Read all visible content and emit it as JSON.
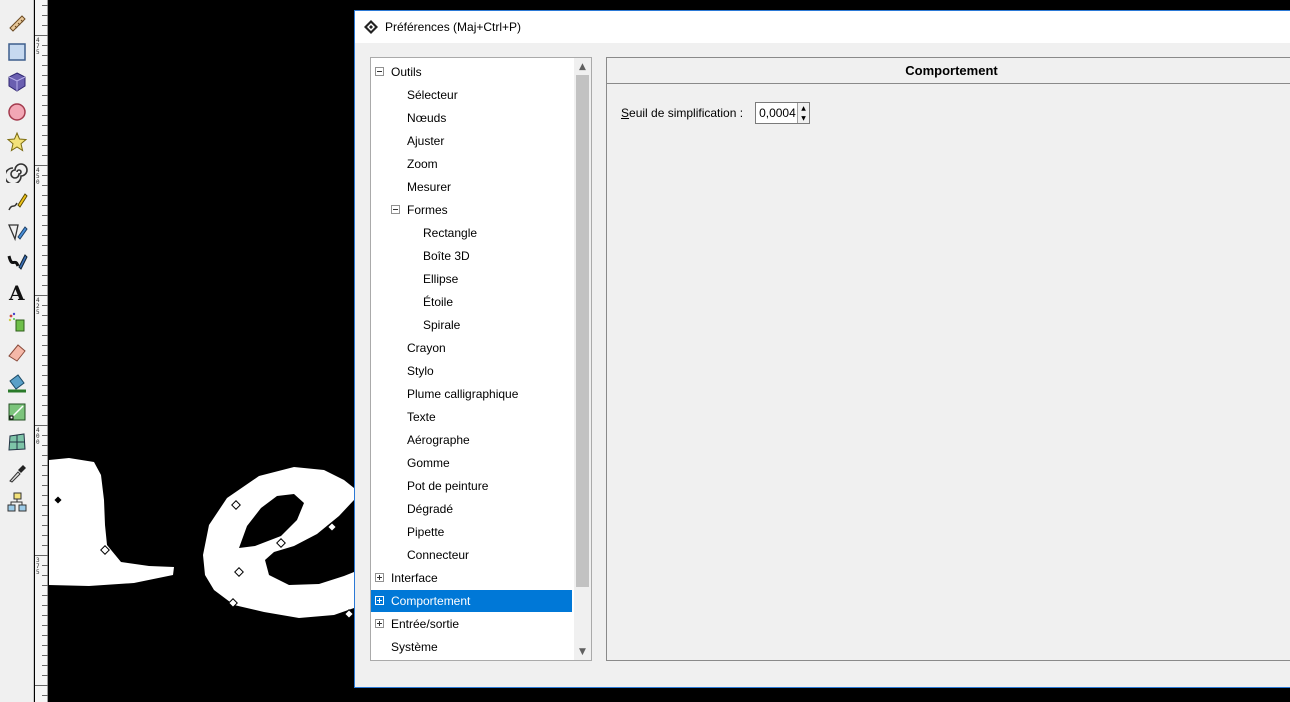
{
  "window": {
    "title": "Préférences (Maj+Ctrl+P)"
  },
  "tree": {
    "items": [
      {
        "label": "Outils",
        "level": 0,
        "expander": "minus"
      },
      {
        "label": "Sélecteur",
        "level": 1
      },
      {
        "label": "Nœuds",
        "level": 1
      },
      {
        "label": "Ajuster",
        "level": 1
      },
      {
        "label": "Zoom",
        "level": 1
      },
      {
        "label": "Mesurer",
        "level": 1
      },
      {
        "label": "Formes",
        "level": 1,
        "expander": "minus"
      },
      {
        "label": "Rectangle",
        "level": 2
      },
      {
        "label": "Boîte 3D",
        "level": 2
      },
      {
        "label": "Ellipse",
        "level": 2
      },
      {
        "label": "Étoile",
        "level": 2
      },
      {
        "label": "Spirale",
        "level": 2
      },
      {
        "label": "Crayon",
        "level": 1
      },
      {
        "label": "Stylo",
        "level": 1
      },
      {
        "label": "Plume calligraphique",
        "level": 1
      },
      {
        "label": "Texte",
        "level": 1
      },
      {
        "label": "Aérographe",
        "level": 1
      },
      {
        "label": "Gomme",
        "level": 1
      },
      {
        "label": "Pot de peinture",
        "level": 1
      },
      {
        "label": "Dégradé",
        "level": 1
      },
      {
        "label": "Pipette",
        "level": 1
      },
      {
        "label": "Connecteur",
        "level": 1
      },
      {
        "label": "Interface",
        "level": 0,
        "expander": "plus"
      },
      {
        "label": "Comportement",
        "level": 0,
        "expander": "plus",
        "selected": true
      },
      {
        "label": "Entrée/sortie",
        "level": 0,
        "expander": "plus"
      },
      {
        "label": "Système",
        "level": 0
      }
    ]
  },
  "panel": {
    "header": "Comportement",
    "simplify": {
      "label_mnemonic": "S",
      "label_rest": "euil de simplification :",
      "value": "0,0004"
    }
  },
  "ruler": {
    "labels": [
      "4\n7\n5",
      "4\n5\n0",
      "4\n2\n5",
      "4\n0\n0",
      "3\n7\n5"
    ]
  },
  "toolbox": {
    "tools": [
      "measure-tool-icon",
      "rectangle-tool-icon",
      "3d-box-tool-icon",
      "ellipse-tool-icon",
      "star-tool-icon",
      "spiral-tool-icon",
      "pencil-tool-icon",
      "pen-tool-icon",
      "calligraphy-tool-icon",
      "text-tool-icon",
      "spray-tool-icon",
      "eraser-tool-icon",
      "paint-bucket-tool-icon",
      "gradient-tool-icon",
      "mesh-tool-icon",
      "dropper-tool-icon",
      "connector-tool-icon"
    ]
  },
  "colors": {
    "selection": "#0078d7",
    "window_border": "#2b79d6",
    "canvas": "#000000"
  }
}
